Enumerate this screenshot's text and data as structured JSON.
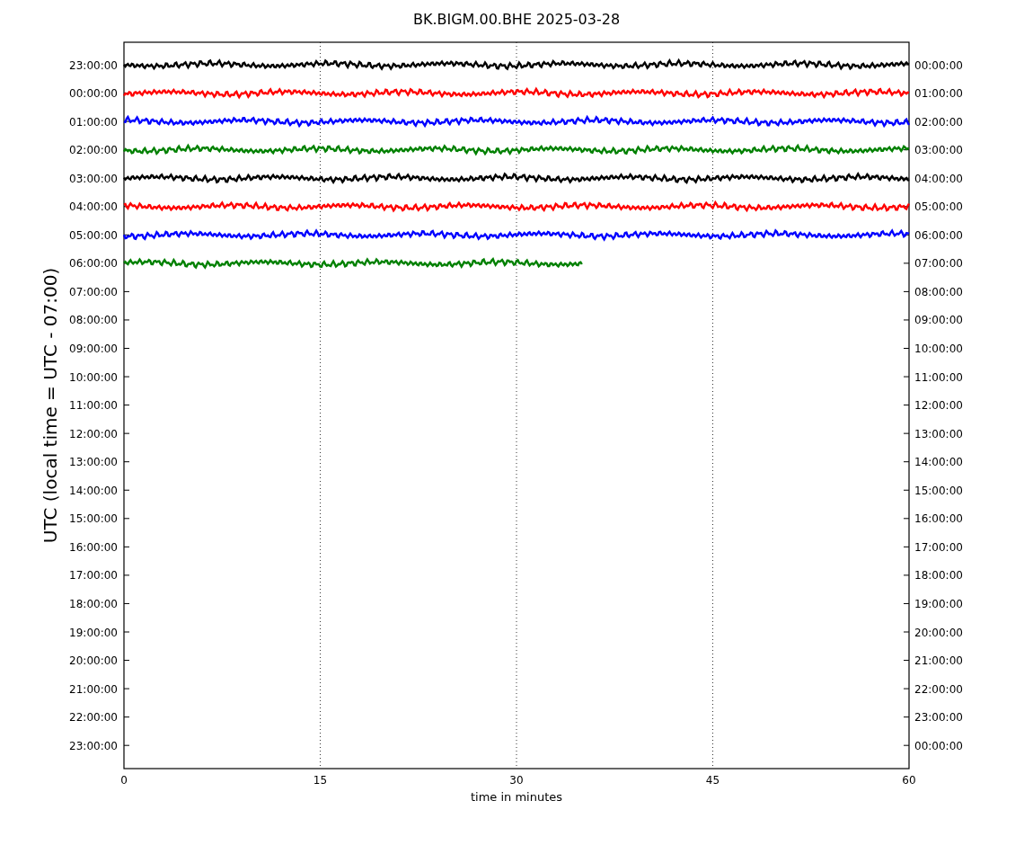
{
  "title": "BK.BIGM.00.BHE 2025-03-28",
  "ylabel": "UTC (local time = UTC - 07:00)",
  "xlabel": "time in minutes",
  "xticks": [
    "0",
    "15",
    "30",
    "45",
    "60"
  ],
  "left_labels": [
    "23:00:00",
    "00:00:00",
    "01:00:00",
    "02:00:00",
    "03:00:00",
    "04:00:00",
    "05:00:00",
    "06:00:00",
    "07:00:00",
    "08:00:00",
    "09:00:00",
    "10:00:00",
    "11:00:00",
    "12:00:00",
    "13:00:00",
    "14:00:00",
    "15:00:00",
    "16:00:00",
    "17:00:00",
    "18:00:00",
    "19:00:00",
    "20:00:00",
    "21:00:00",
    "22:00:00",
    "23:00:00"
  ],
  "right_labels": [
    "00:00:00",
    "01:00:00",
    "02:00:00",
    "03:00:00",
    "04:00:00",
    "05:00:00",
    "06:00:00",
    "07:00:00",
    "08:00:00",
    "09:00:00",
    "10:00:00",
    "11:00:00",
    "12:00:00",
    "13:00:00",
    "14:00:00",
    "15:00:00",
    "16:00:00",
    "17:00:00",
    "18:00:00",
    "19:00:00",
    "20:00:00",
    "21:00:00",
    "22:00:00",
    "23:00:00",
    "00:00:00"
  ],
  "traces": [
    {
      "color": "#000000",
      "level": 1
    },
    {
      "color": "#ff0000",
      "level": 1
    },
    {
      "color": "#0000ff",
      "level": 1
    },
    {
      "color": "#008000",
      "level": 1
    },
    {
      "color": "#000000",
      "level": 1
    },
    {
      "color": "#ff0000",
      "level": 1
    },
    {
      "color": "#0000ff",
      "level": 1
    },
    {
      "color": "#008000",
      "level": 0.583
    }
  ]
}
